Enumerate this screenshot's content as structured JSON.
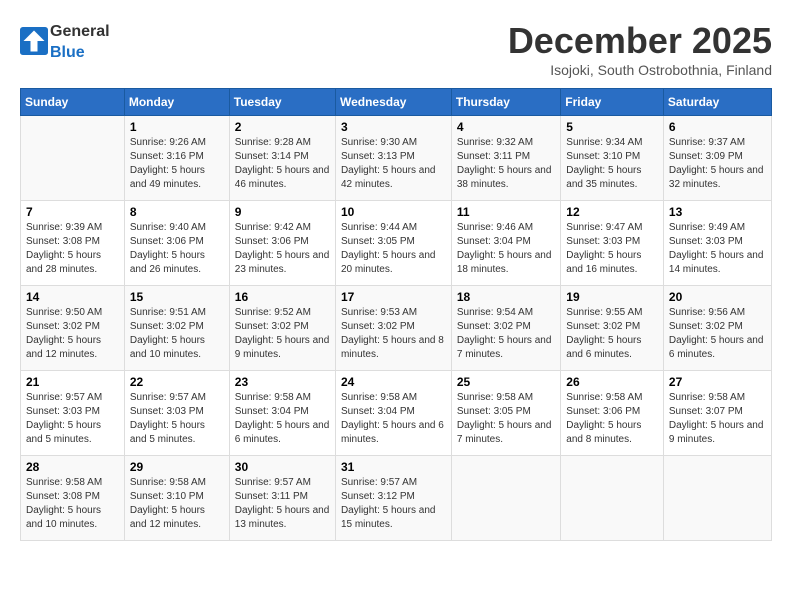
{
  "header": {
    "logo_general": "General",
    "logo_blue": "Blue",
    "month_title": "December 2025",
    "location": "Isojoki, South Ostrobothnia, Finland"
  },
  "weekdays": [
    "Sunday",
    "Monday",
    "Tuesday",
    "Wednesday",
    "Thursday",
    "Friday",
    "Saturday"
  ],
  "weeks": [
    [
      {
        "day": "",
        "info": ""
      },
      {
        "day": "1",
        "info": "Sunrise: 9:26 AM\nSunset: 3:16 PM\nDaylight: 5 hours and 49 minutes."
      },
      {
        "day": "2",
        "info": "Sunrise: 9:28 AM\nSunset: 3:14 PM\nDaylight: 5 hours and 46 minutes."
      },
      {
        "day": "3",
        "info": "Sunrise: 9:30 AM\nSunset: 3:13 PM\nDaylight: 5 hours and 42 minutes."
      },
      {
        "day": "4",
        "info": "Sunrise: 9:32 AM\nSunset: 3:11 PM\nDaylight: 5 hours and 38 minutes."
      },
      {
        "day": "5",
        "info": "Sunrise: 9:34 AM\nSunset: 3:10 PM\nDaylight: 5 hours and 35 minutes."
      },
      {
        "day": "6",
        "info": "Sunrise: 9:37 AM\nSunset: 3:09 PM\nDaylight: 5 hours and 32 minutes."
      }
    ],
    [
      {
        "day": "7",
        "info": "Sunrise: 9:39 AM\nSunset: 3:08 PM\nDaylight: 5 hours and 28 minutes."
      },
      {
        "day": "8",
        "info": "Sunrise: 9:40 AM\nSunset: 3:06 PM\nDaylight: 5 hours and 26 minutes."
      },
      {
        "day": "9",
        "info": "Sunrise: 9:42 AM\nSunset: 3:06 PM\nDaylight: 5 hours and 23 minutes."
      },
      {
        "day": "10",
        "info": "Sunrise: 9:44 AM\nSunset: 3:05 PM\nDaylight: 5 hours and 20 minutes."
      },
      {
        "day": "11",
        "info": "Sunrise: 9:46 AM\nSunset: 3:04 PM\nDaylight: 5 hours and 18 minutes."
      },
      {
        "day": "12",
        "info": "Sunrise: 9:47 AM\nSunset: 3:03 PM\nDaylight: 5 hours and 16 minutes."
      },
      {
        "day": "13",
        "info": "Sunrise: 9:49 AM\nSunset: 3:03 PM\nDaylight: 5 hours and 14 minutes."
      }
    ],
    [
      {
        "day": "14",
        "info": "Sunrise: 9:50 AM\nSunset: 3:02 PM\nDaylight: 5 hours and 12 minutes."
      },
      {
        "day": "15",
        "info": "Sunrise: 9:51 AM\nSunset: 3:02 PM\nDaylight: 5 hours and 10 minutes."
      },
      {
        "day": "16",
        "info": "Sunrise: 9:52 AM\nSunset: 3:02 PM\nDaylight: 5 hours and 9 minutes."
      },
      {
        "day": "17",
        "info": "Sunrise: 9:53 AM\nSunset: 3:02 PM\nDaylight: 5 hours and 8 minutes."
      },
      {
        "day": "18",
        "info": "Sunrise: 9:54 AM\nSunset: 3:02 PM\nDaylight: 5 hours and 7 minutes."
      },
      {
        "day": "19",
        "info": "Sunrise: 9:55 AM\nSunset: 3:02 PM\nDaylight: 5 hours and 6 minutes."
      },
      {
        "day": "20",
        "info": "Sunrise: 9:56 AM\nSunset: 3:02 PM\nDaylight: 5 hours and 6 minutes."
      }
    ],
    [
      {
        "day": "21",
        "info": "Sunrise: 9:57 AM\nSunset: 3:03 PM\nDaylight: 5 hours and 5 minutes."
      },
      {
        "day": "22",
        "info": "Sunrise: 9:57 AM\nSunset: 3:03 PM\nDaylight: 5 hours and 5 minutes."
      },
      {
        "day": "23",
        "info": "Sunrise: 9:58 AM\nSunset: 3:04 PM\nDaylight: 5 hours and 6 minutes."
      },
      {
        "day": "24",
        "info": "Sunrise: 9:58 AM\nSunset: 3:04 PM\nDaylight: 5 hours and 6 minutes."
      },
      {
        "day": "25",
        "info": "Sunrise: 9:58 AM\nSunset: 3:05 PM\nDaylight: 5 hours and 7 minutes."
      },
      {
        "day": "26",
        "info": "Sunrise: 9:58 AM\nSunset: 3:06 PM\nDaylight: 5 hours and 8 minutes."
      },
      {
        "day": "27",
        "info": "Sunrise: 9:58 AM\nSunset: 3:07 PM\nDaylight: 5 hours and 9 minutes."
      }
    ],
    [
      {
        "day": "28",
        "info": "Sunrise: 9:58 AM\nSunset: 3:08 PM\nDaylight: 5 hours and 10 minutes."
      },
      {
        "day": "29",
        "info": "Sunrise: 9:58 AM\nSunset: 3:10 PM\nDaylight: 5 hours and 12 minutes."
      },
      {
        "day": "30",
        "info": "Sunrise: 9:57 AM\nSunset: 3:11 PM\nDaylight: 5 hours and 13 minutes."
      },
      {
        "day": "31",
        "info": "Sunrise: 9:57 AM\nSunset: 3:12 PM\nDaylight: 5 hours and 15 minutes."
      },
      {
        "day": "",
        "info": ""
      },
      {
        "day": "",
        "info": ""
      },
      {
        "day": "",
        "info": ""
      }
    ]
  ]
}
